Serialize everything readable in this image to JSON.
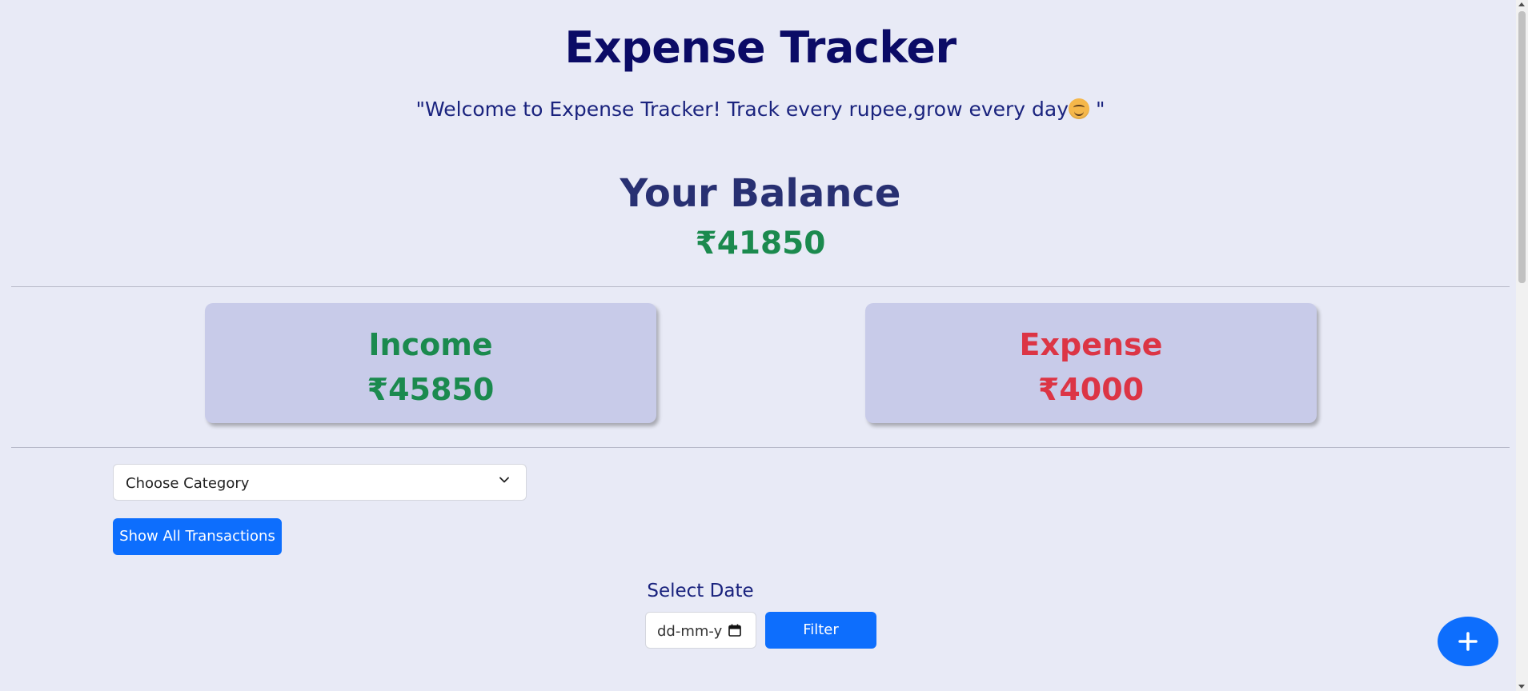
{
  "header": {
    "title": "Expense Tracker",
    "tagline_before_emoji": "\"Welcome to Expense Tracker! Track every rupee,grow every day",
    "tagline_emoji": "smiling-face-icon",
    "tagline_after_emoji": " \""
  },
  "balance": {
    "heading": "Your Balance",
    "amount": "₹41850"
  },
  "income": {
    "label": "Income",
    "amount": "₹45850"
  },
  "expense": {
    "label": "Expense",
    "amount": "₹4000"
  },
  "filters": {
    "category_placeholder": "Choose Category",
    "show_all_label": "Show All Transactions",
    "date_label": "Select Date",
    "date_placeholder": "dd-mm-y",
    "filter_label": "Filter"
  },
  "fab": {
    "icon": "plus-icon"
  },
  "colors": {
    "background": "#e8eaf6",
    "title": "#0b0b66",
    "income": "#1b8a4e",
    "expense": "#dc3545",
    "card": "#c8cbe9",
    "primary": "#0d6efd"
  }
}
